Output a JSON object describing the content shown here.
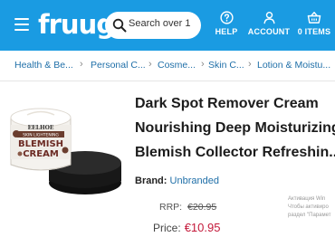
{
  "header": {
    "logo": "fruugo",
    "search_placeholder": "Search over 1",
    "help_label": "HELP",
    "account_label": "ACCOUNT",
    "items_label": "0 ITEMS",
    "colors": {
      "bar": "#1a9be2",
      "text": "#ffffff"
    }
  },
  "breadcrumb": [
    "Health & Be...",
    "Personal C...",
    "Cosme...",
    "Skin C...",
    "Lotion & Moistu..."
  ],
  "product": {
    "image_texts": [
      "EELHOE",
      "SKIN LIGHTENING",
      "BLEMISH",
      "CREAM"
    ],
    "title_lines": [
      "Dark Spot Remover Cream",
      "Nourishing Deep Moisturizing",
      "Blemish Collector Refreshin..."
    ],
    "brand_label": "Brand:",
    "brand_value": "Unbranded",
    "rrp_label": "RRP:",
    "rrp_value": "€20.95",
    "price_label": "Price:",
    "price_value": "€10.95",
    "price_color": "#c4193a"
  },
  "watermark": [
    "Активация Win",
    "Чтобы активиро",
    "раздел \"Парамет"
  ]
}
